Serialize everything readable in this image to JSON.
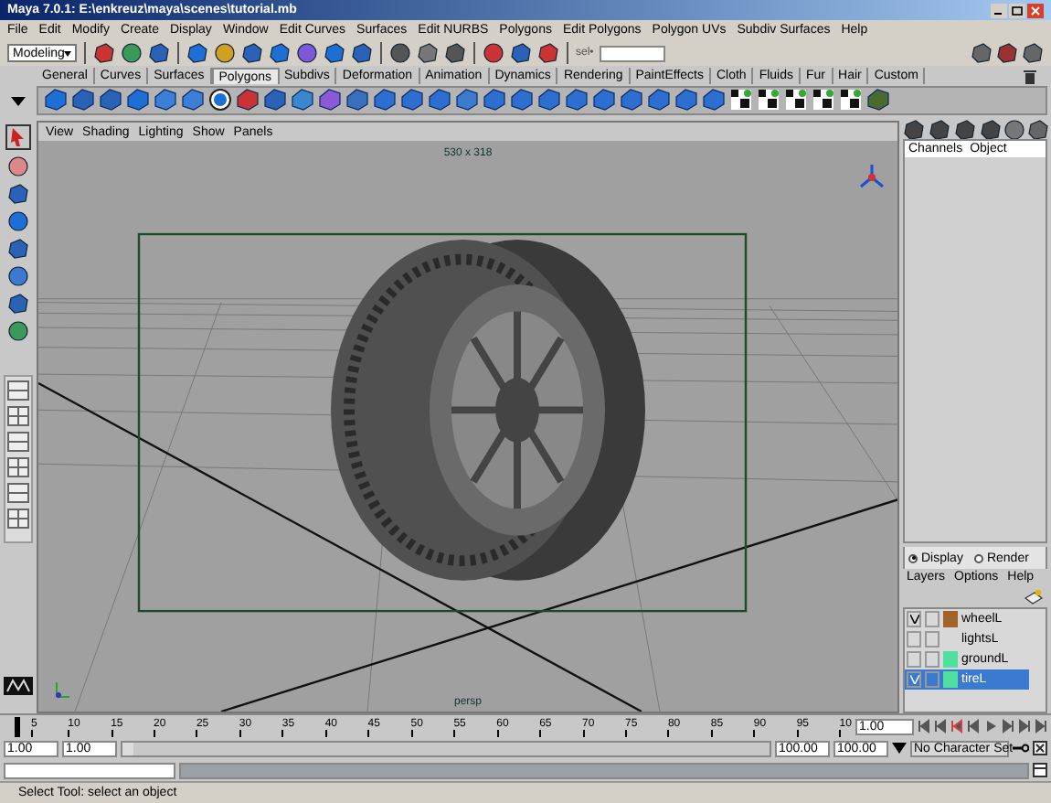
{
  "window": {
    "title": "Maya 7.0.1: E:\\enkreuz\\maya\\scenes\\tutorial.mb"
  },
  "menu_bar": [
    "File",
    "Edit",
    "Modify",
    "Create",
    "Display",
    "Window",
    "Edit Curves",
    "Surfaces",
    "Edit NURBS",
    "Polygons",
    "Edit Polygons",
    "Polygon UVs",
    "Subdiv Surfaces",
    "Help"
  ],
  "status_line": {
    "mode": "Modeling",
    "selection_label": "sel•"
  },
  "shelf_tabs": [
    {
      "label": "General",
      "selected": false
    },
    {
      "label": "Curves",
      "selected": false
    },
    {
      "label": "Surfaces",
      "selected": false
    },
    {
      "label": "Polygons",
      "selected": true
    },
    {
      "label": "Subdivs",
      "selected": false
    },
    {
      "label": "Deformation",
      "selected": false
    },
    {
      "label": "Animation",
      "selected": false
    },
    {
      "label": "Dynamics",
      "selected": false
    },
    {
      "label": "Rendering",
      "selected": false
    },
    {
      "label": "PaintEffects",
      "selected": false
    },
    {
      "label": "Cloth",
      "selected": false
    },
    {
      "label": "Fluids",
      "selected": false
    },
    {
      "label": "Fur",
      "selected": false
    },
    {
      "label": "Hair",
      "selected": false
    },
    {
      "label": "Custom",
      "selected": false
    }
  ],
  "viewport": {
    "menus": [
      "View",
      "Shading",
      "Lighting",
      "Show",
      "Panels"
    ],
    "resolution": "530 x 318",
    "camera": "persp"
  },
  "channel_box": {
    "menus": [
      "Channels",
      "Object"
    ]
  },
  "layer_editor": {
    "modes": [
      {
        "label": "Display",
        "selected": true
      },
      {
        "label": "Render",
        "selected": false
      }
    ],
    "menus": [
      "Layers",
      "Options",
      "Help"
    ],
    "layers": [
      {
        "name": "wheelL",
        "visible": true,
        "color": "#a0642a",
        "selected": false
      },
      {
        "name": "lightsL",
        "visible": false,
        "selected": false
      },
      {
        "name": "groundL",
        "visible": false,
        "color": "#50e0a0",
        "selected": false
      },
      {
        "name": "tireL",
        "visible": true,
        "color": "#50e0a0",
        "selected": true
      }
    ]
  },
  "time_slider": {
    "ticks": [
      "5",
      "10",
      "15",
      "20",
      "25",
      "30",
      "35",
      "40",
      "45",
      "50",
      "55",
      "60",
      "65",
      "70",
      "75",
      "80",
      "85",
      "90",
      "95",
      "10"
    ],
    "current_time": "1.00"
  },
  "range_slider": {
    "level": 1,
    "start_time": "1.00",
    "start_range": "1.00",
    "end_range": "100.00",
    "end_time": "100.00",
    "character_set": "No Character Set"
  },
  "help_line": "Select Tool: select an object"
}
